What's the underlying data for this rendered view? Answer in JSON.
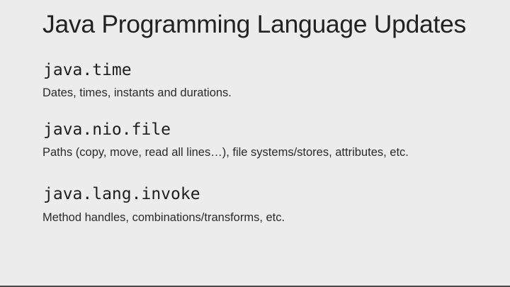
{
  "slide": {
    "title": "Java Programming Language Updates",
    "items": [
      {
        "package": "java.time",
        "description": "Dates, times, instants and durations."
      },
      {
        "package": "java.nio.file",
        "description": "Paths (copy, move, read all lines…), file systems/stores, attributes, etc."
      },
      {
        "package": "java.lang.invoke",
        "description": "Method handles, combinations/transforms, etc."
      }
    ]
  },
  "colors": {
    "background": "#ececec",
    "text": "#222222",
    "bottom_border": "#4a4a4a"
  }
}
